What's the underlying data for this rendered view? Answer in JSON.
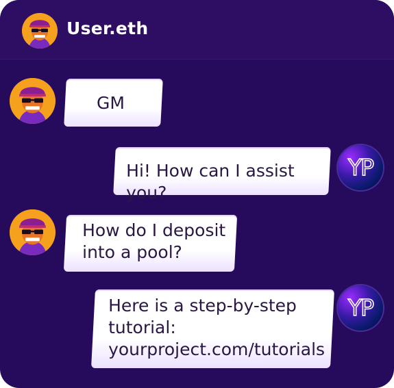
{
  "header": {
    "title": "User.eth",
    "avatar_icon": "ape-avatar-icon"
  },
  "messages": [
    {
      "sender": "user",
      "text": "GM"
    },
    {
      "sender": "bot",
      "text": "Hi! How can I assist you?"
    },
    {
      "sender": "user",
      "lines": [
        "How do I deposit",
        "into a pool?"
      ]
    },
    {
      "sender": "bot",
      "lines": [
        "Here is a step-by-step",
        "tutorial:",
        "yourproject.com/tutorials"
      ]
    }
  ],
  "bot_avatar": {
    "label": "YP"
  },
  "colors": {
    "background": "#260b5d",
    "header": "#2e0e63",
    "bubble": "#ffffff",
    "avatar_bg": "#f6a11d",
    "accent": "#9b2cff"
  }
}
